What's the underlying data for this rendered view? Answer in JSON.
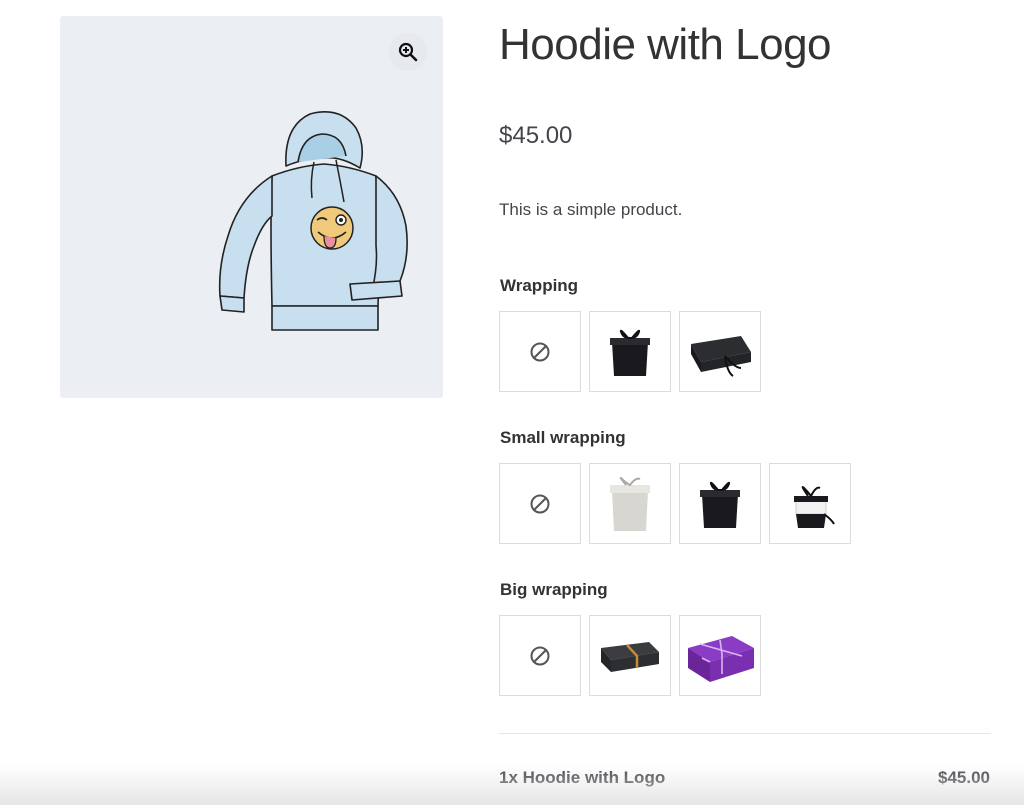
{
  "product": {
    "title": "Hoodie with Logo",
    "price": "$45.00",
    "description": "This is a simple product."
  },
  "gallery": {
    "zoom_icon": "zoom-in-icon",
    "image": "hoodie-with-logo"
  },
  "addon_groups": [
    {
      "label": "Wrapping",
      "options": [
        "none",
        "black-gift-box",
        "black-flat-box"
      ]
    },
    {
      "label": "Small wrapping",
      "options": [
        "none",
        "white-gift-box",
        "black-gift-box",
        "black-white-gift-box"
      ]
    },
    {
      "label": "Big wrapping",
      "options": [
        "none",
        "black-gold-box",
        "purple-gift-box"
      ]
    }
  ],
  "summary": {
    "item": "1x Hoodie with Logo",
    "total": "$45.00"
  },
  "colors": {
    "gallery_bg": "#ebeef2",
    "hoodie": "#c7dfee",
    "emoji": "#f0c97a",
    "purple_box": "#7a2fb0"
  }
}
